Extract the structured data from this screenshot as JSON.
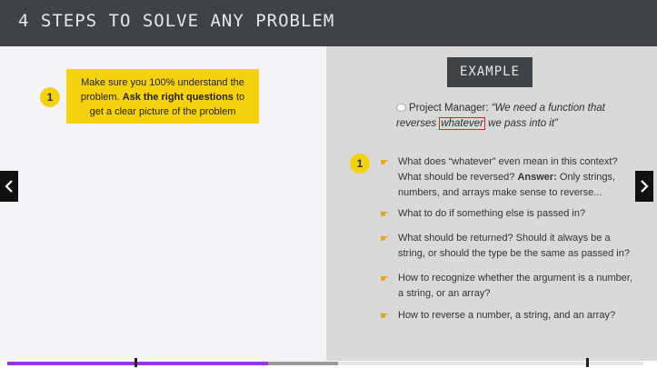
{
  "header": {
    "title": "4 STEPS TO SOLVE ANY PROBLEM"
  },
  "left": {
    "step_number": "1",
    "box_text_1": "Make sure you 100% understand the problem. ",
    "box_text_bold": "Ask the right questions",
    "box_text_2": " to get a clear picture of the problem"
  },
  "right": {
    "example_label": "EXAMPLE",
    "quote": {
      "speaker": "Project Manager:",
      "text_1": " “We need a function that reverses ",
      "highlight": "whatever",
      "text_2": " we pass into it”"
    },
    "list_number": "1",
    "items": [
      {
        "pre": "What does “whatever” even mean in this context? What should be reversed? ",
        "bold": "Answer:",
        "post": " Only strings, numbers, and arrays make sense to reverse..."
      },
      {
        "pre": "What to do if something else is passed in?",
        "bold": "",
        "post": ""
      },
      {
        "pre": "What should be returned? Should it always be a string, or should the type be the same as passed in?",
        "bold": "",
        "post": ""
      },
      {
        "pre": "How to recognize whether the argument is a number, a string, or an array?",
        "bold": "",
        "post": ""
      },
      {
        "pre": "How to reverse a number, a string, and an array?",
        "bold": "",
        "post": ""
      }
    ]
  },
  "nav": {
    "prev_icon": "chevron-left-icon",
    "next_icon": "chevron-right-icon"
  },
  "progress": {
    "played_fraction": 0.41,
    "buffered_fraction": 0.52
  },
  "colors": {
    "accent_yellow": "#f5d20f",
    "header_dark": "#3f4347",
    "progress_purple": "#9b30f0",
    "highlight_red": "#e02424"
  }
}
